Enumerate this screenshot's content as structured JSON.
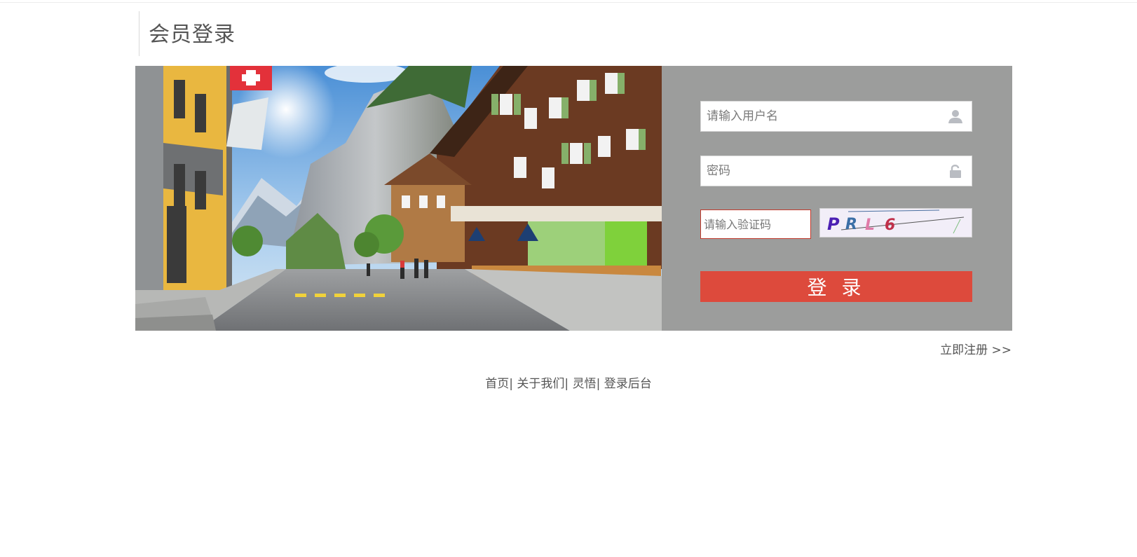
{
  "page": {
    "title": "会员登录"
  },
  "login_form": {
    "username_placeholder": "请输入用户名",
    "password_placeholder": "密码",
    "captcha_placeholder": "请输入验证码",
    "captcha_text": "PRL6",
    "submit_label": "登 录",
    "username_icon": "user-icon",
    "password_icon": "lock-icon"
  },
  "register": {
    "label": "立即注册 >>"
  },
  "footer": {
    "links": [
      "首页",
      "关于我们",
      "灵悟",
      "登录后台"
    ],
    "separator": "|"
  },
  "colors": {
    "panel_bg": "#9c9d9c",
    "accent": "#dd4a3c",
    "captcha_border": "#c0392b"
  }
}
